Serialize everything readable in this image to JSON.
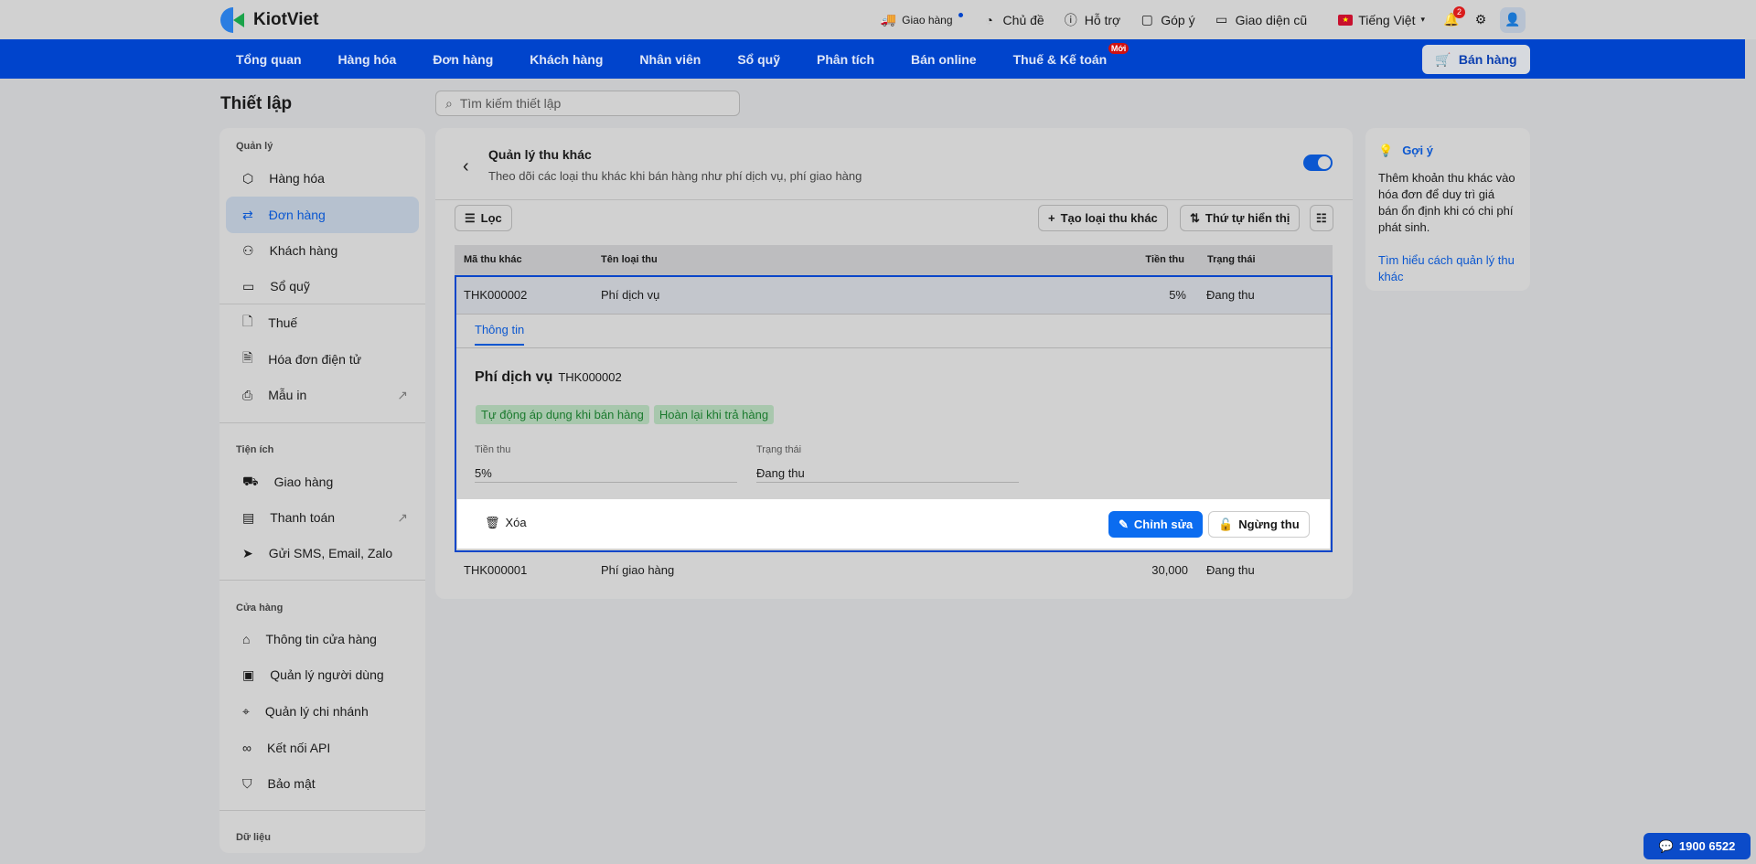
{
  "header": {
    "brand": "KiotViet",
    "links": [
      {
        "label": "Giao hàng",
        "icon": "truck-icon"
      },
      {
        "label": "Chủ đề",
        "icon": "palette-icon"
      },
      {
        "label": "Hỗ trợ",
        "icon": "support-icon"
      },
      {
        "label": "Góp ý",
        "icon": "feedback-icon"
      },
      {
        "label": "Giao diện cũ",
        "icon": "monitor-icon"
      }
    ],
    "language": "Tiếng Việt",
    "notifications": "2"
  },
  "nav": {
    "items": [
      "Tổng quan",
      "Hàng hóa",
      "Đơn hàng",
      "Khách hàng",
      "Nhân viên",
      "Sổ quỹ",
      "Phân tích",
      "Bán online",
      "Thuế & Kế toán"
    ],
    "new_badge": "Mới",
    "sell_button": "Bán hàng"
  },
  "page": {
    "title": "Thiết lập",
    "search_placeholder": "Tìm kiếm thiết lập"
  },
  "sidebar": {
    "sections": [
      "Quản lý",
      "Tiện ích",
      "Cửa hàng",
      "Dữ liệu"
    ],
    "items": [
      "Hàng hóa",
      "Đơn hàng",
      "Khách hàng",
      "Sổ quỹ",
      "Thuế",
      "Hóa đơn điện tử",
      "Mẫu in",
      "Giao hàng",
      "Thanh toán",
      "Gửi SMS, Email, Zalo",
      "Thông tin cửa hàng",
      "Quản lý người dùng",
      "Quản lý chi nhánh",
      "Kết nối API",
      "Bảo mật"
    ]
  },
  "main": {
    "title": "Quản lý thu khác",
    "subtitle": "Theo dõi các loại thu khác khi bán hàng như phí dịch vụ, phí giao hàng",
    "enabled": true,
    "filter_button": "Lọc",
    "create_button": "Tạo loại thu khác",
    "order_button": "Thứ tự hiển thị",
    "columns": [
      "Mã thu khác",
      "Tên loại thu",
      "Tiền thu",
      "Trạng thái"
    ],
    "rows": [
      {
        "code": "THK000002",
        "name": "Phí dịch vụ",
        "amount": "5%",
        "status": "Đang thu"
      },
      {
        "code": "THK000001",
        "name": "Phí giao hàng",
        "amount": "30,000",
        "status": "Đang thu"
      }
    ],
    "detail": {
      "tab": "Thông tin",
      "name": "Phí dịch vụ",
      "code": "THK000002",
      "tags": [
        "Tự động áp dụng khi bán hàng",
        "Hoàn lại khi trả hàng"
      ],
      "amount_label": "Tiền thu",
      "amount": "5%",
      "status_label": "Trạng thái",
      "status": "Đang thu",
      "delete": "Xóa",
      "edit": "Chỉnh sửa",
      "stop": "Ngừng thu"
    }
  },
  "hint": {
    "title": "Gợi ý",
    "text": "Thêm khoản thu khác vào hóa đơn để duy trì giá bán ổn định khi có chi phí phát sinh.",
    "link": "Tìm hiểu cách quản lý thu khác"
  },
  "support": {
    "phone": "1900 6522"
  }
}
